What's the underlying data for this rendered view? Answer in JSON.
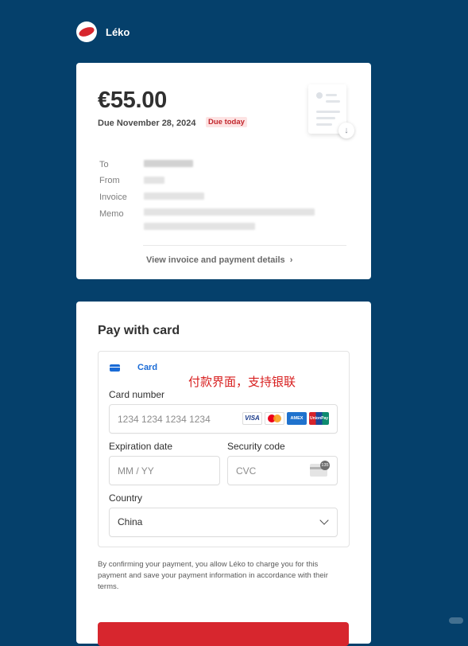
{
  "brand": {
    "name": "Léko",
    "logo_icon": "leko-logo"
  },
  "invoice": {
    "amount": "€55.00",
    "due_date": "Due November 28, 2024",
    "due_badge": "Due today",
    "details": [
      {
        "label": "To"
      },
      {
        "label": "From"
      },
      {
        "label": "Invoice"
      },
      {
        "label": "Memo"
      }
    ],
    "view_details_link": "View invoice and payment details",
    "view_details_icon": "chevron-right-icon",
    "illustration_icon": "invoice-document-icon"
  },
  "payment": {
    "title": "Pay with card",
    "method_tab": {
      "label": "Card",
      "icon": "credit-card-icon"
    },
    "annotation": "付款界面，支持银联",
    "card_number": {
      "label": "Card number",
      "placeholder": "1234 1234 1234 1234"
    },
    "card_brands": [
      "VISA",
      "Mastercard",
      "AMEX",
      "UnionPay"
    ],
    "expiration": {
      "label": "Expiration date",
      "placeholder": "MM / YY"
    },
    "security": {
      "label": "Security code",
      "placeholder": "CVC",
      "icon_text": "135"
    },
    "country": {
      "label": "Country",
      "value": "China"
    },
    "consent": "By confirming your payment, you allow Léko to charge you for this payment and save your payment information in accordance with their terms."
  },
  "colors": {
    "background": "#05406b",
    "accent_red": "#d7262e",
    "link_blue": "#1a6bd6",
    "badge_red": "#c2272d"
  }
}
